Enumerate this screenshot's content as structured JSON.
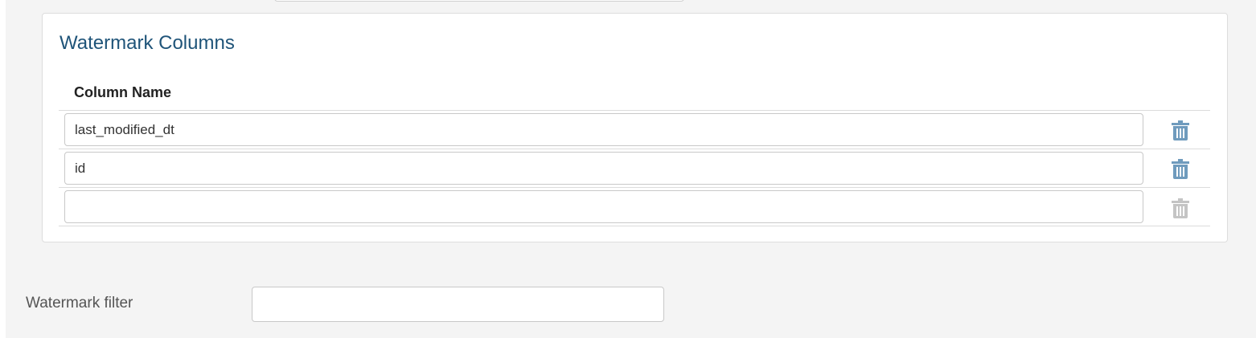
{
  "panel": {
    "title": "Watermark Columns",
    "column_header": "Column Name",
    "rows": [
      {
        "value": "last_modified_dt",
        "delete_enabled": true
      },
      {
        "value": "id",
        "delete_enabled": true
      },
      {
        "value": "",
        "delete_enabled": false
      }
    ]
  },
  "filter": {
    "label": "Watermark filter",
    "value": ""
  },
  "colors": {
    "title": "#1f5479",
    "trash_active": "#6f9bbd",
    "trash_disabled": "#c4c4c4"
  },
  "icons": {
    "delete": "trash-icon"
  }
}
